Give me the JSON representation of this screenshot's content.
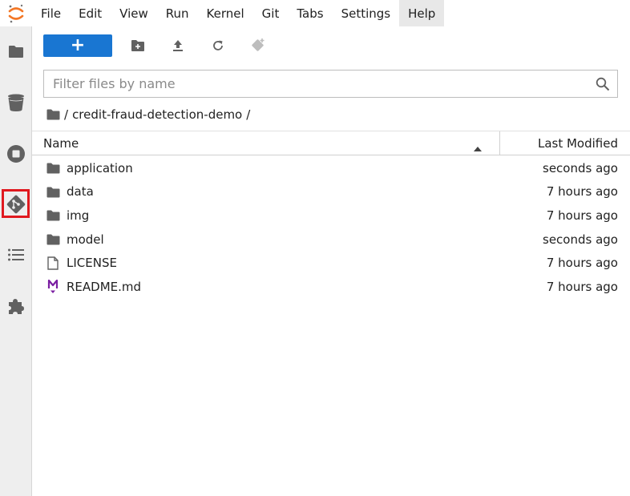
{
  "menubar": {
    "items": [
      "File",
      "Edit",
      "View",
      "Run",
      "Kernel",
      "Git",
      "Tabs",
      "Settings",
      "Help"
    ],
    "active_item": "Help"
  },
  "sidebar": {
    "icons": [
      "folder-icon",
      "running-icon",
      "stop-icon",
      "git-icon",
      "toc-icon",
      "extension-icon"
    ],
    "highlighted": "git-icon"
  },
  "toolbar": {
    "new_label": "+"
  },
  "filter": {
    "placeholder": "Filter files by name",
    "value": ""
  },
  "breadcrumbs": {
    "sep1": "/",
    "folder": "credit-fraud-detection-demo",
    "sep2": "/"
  },
  "columns": {
    "name": "Name",
    "modified": "Last Modified"
  },
  "files": [
    {
      "name": "application",
      "modified": "seconds ago",
      "type": "folder"
    },
    {
      "name": "data",
      "modified": "7 hours ago",
      "type": "folder"
    },
    {
      "name": "img",
      "modified": "7 hours ago",
      "type": "folder"
    },
    {
      "name": "model",
      "modified": "seconds ago",
      "type": "folder"
    },
    {
      "name": "LICENSE",
      "modified": "7 hours ago",
      "type": "file"
    },
    {
      "name": "README.md",
      "modified": "7 hours ago",
      "type": "markdown"
    }
  ],
  "colors": {
    "accent": "#1976d2",
    "highlight": "#e0191f",
    "markdown": "#7b1fa2",
    "logo": "#f37726"
  }
}
